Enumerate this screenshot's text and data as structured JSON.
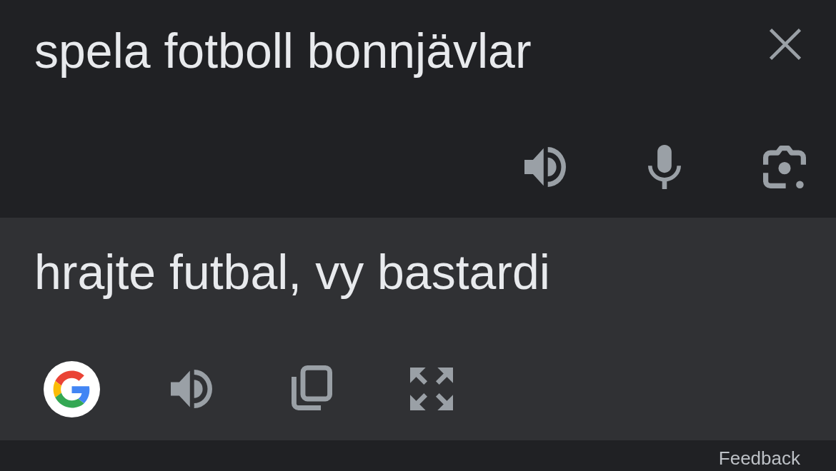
{
  "input": {
    "value": "spela fotboll bonnjävlar"
  },
  "translation": {
    "text": "hrajte futbal, vy bastardi"
  },
  "footer": {
    "link": "Feedback"
  }
}
